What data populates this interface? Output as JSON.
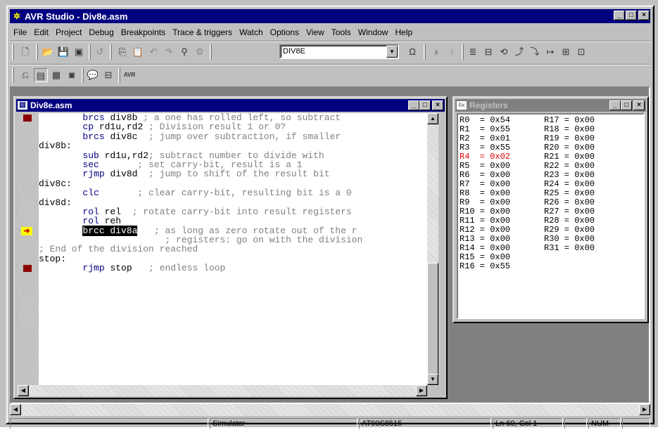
{
  "window": {
    "title": "AVR Studio - Div8e.asm",
    "min": "_",
    "max": "□",
    "close": "×"
  },
  "menu": [
    "File",
    "Edit",
    "Project",
    "Debug",
    "Breakpoints",
    "Trace & triggers",
    "Watch",
    "Options",
    "View",
    "Tools",
    "Window",
    "Help"
  ],
  "toolbar": {
    "combo_value": "DIV8E"
  },
  "code_window": {
    "title": "Div8e.asm",
    "lines": [
      {
        "marker": "bp",
        "parts": [
          [
            "        ",
            ""
          ],
          [
            "brcs",
            "kw"
          ],
          [
            " div8b",
            "id"
          ],
          [
            " ; a one has rolled left, so subtract",
            "cm"
          ]
        ]
      },
      {
        "marker": "",
        "parts": [
          [
            "        ",
            ""
          ],
          [
            "cp",
            "kw"
          ],
          [
            " rd1u,rd2",
            "id"
          ],
          [
            " ; Division result 1 or 0?",
            "cm"
          ]
        ]
      },
      {
        "marker": "",
        "parts": [
          [
            "        ",
            ""
          ],
          [
            "brcs",
            "kw"
          ],
          [
            " div8c",
            "id"
          ],
          [
            "  ; jump over subtraction, if smaller",
            "cm"
          ]
        ]
      },
      {
        "marker": "",
        "parts": [
          [
            "div8b:",
            "id"
          ]
        ]
      },
      {
        "marker": "",
        "parts": [
          [
            "        ",
            ""
          ],
          [
            "sub",
            "kw"
          ],
          [
            " rd1u,rd2",
            "id"
          ],
          [
            "; subtract number to divide with",
            "cm"
          ]
        ]
      },
      {
        "marker": "",
        "parts": [
          [
            "        ",
            ""
          ],
          [
            "sec",
            "kw"
          ],
          [
            "       ; set carry-bit, result is a 1",
            "cm"
          ]
        ]
      },
      {
        "marker": "",
        "parts": [
          [
            "        ",
            ""
          ],
          [
            "rjmp",
            "kw"
          ],
          [
            " div8d",
            "id"
          ],
          [
            "  ; jump to shift of the result bit",
            "cm"
          ]
        ]
      },
      {
        "marker": "",
        "parts": [
          [
            "div8c:",
            "id"
          ]
        ]
      },
      {
        "marker": "",
        "parts": [
          [
            "        ",
            ""
          ],
          [
            "clc",
            "kw"
          ],
          [
            "       ; clear carry-bit, resulting bit is a 0",
            "cm"
          ]
        ]
      },
      {
        "marker": "",
        "parts": [
          [
            "div8d:",
            "id"
          ]
        ]
      },
      {
        "marker": "",
        "parts": [
          [
            "        ",
            ""
          ],
          [
            "rol",
            "kw"
          ],
          [
            " rel",
            "id"
          ],
          [
            "  ; rotate carry-bit into result registers",
            "cm"
          ]
        ]
      },
      {
        "marker": "",
        "parts": [
          [
            "        ",
            ""
          ],
          [
            "rol",
            "kw"
          ],
          [
            " reh",
            "id"
          ]
        ]
      },
      {
        "marker": "arrow",
        "parts": [
          [
            "        ",
            ""
          ],
          [
            "brcc div8a",
            "hl"
          ],
          [
            "   ; as long as zero rotate out of the r",
            "cm"
          ]
        ]
      },
      {
        "marker": "",
        "parts": [
          [
            "                       ; registers: go on with the division",
            "cm"
          ]
        ]
      },
      {
        "marker": "",
        "parts": [
          [
            "; End of the division reached",
            "cm"
          ]
        ]
      },
      {
        "marker": "",
        "parts": [
          [
            "stop:",
            "id"
          ]
        ]
      },
      {
        "marker": "bp",
        "parts": [
          [
            "        ",
            ""
          ],
          [
            "rjmp",
            "kw"
          ],
          [
            " stop",
            "id"
          ],
          [
            "   ; endless loop",
            "cm"
          ]
        ]
      }
    ]
  },
  "registers_window": {
    "title": "Registers",
    "col1": [
      {
        "name": "R0",
        "value": "0x54"
      },
      {
        "name": "R1",
        "value": "0x55"
      },
      {
        "name": "R2",
        "value": "0x01"
      },
      {
        "name": "R3",
        "value": "0x55"
      },
      {
        "name": "R4",
        "value": "0x02",
        "changed": true
      },
      {
        "name": "R5",
        "value": "0x00"
      },
      {
        "name": "R6",
        "value": "0x00"
      },
      {
        "name": "R7",
        "value": "0x00"
      },
      {
        "name": "R8",
        "value": "0x00"
      },
      {
        "name": "R9",
        "value": "0x00"
      },
      {
        "name": "R10",
        "value": "0x00"
      },
      {
        "name": "R11",
        "value": "0x00"
      },
      {
        "name": "R12",
        "value": "0x00"
      },
      {
        "name": "R13",
        "value": "0x00"
      },
      {
        "name": "R14",
        "value": "0x00"
      },
      {
        "name": "R15",
        "value": "0x00"
      },
      {
        "name": "R16",
        "value": "0x55"
      }
    ],
    "col2": [
      {
        "name": "R17",
        "value": "0x00"
      },
      {
        "name": "R18",
        "value": "0x00"
      },
      {
        "name": "R19",
        "value": "0x00"
      },
      {
        "name": "R20",
        "value": "0x00"
      },
      {
        "name": "R21",
        "value": "0x00"
      },
      {
        "name": "R22",
        "value": "0x00"
      },
      {
        "name": "R23",
        "value": "0x00"
      },
      {
        "name": "R24",
        "value": "0x00"
      },
      {
        "name": "R25",
        "value": "0x00"
      },
      {
        "name": "R26",
        "value": "0x00"
      },
      {
        "name": "R27",
        "value": "0x00"
      },
      {
        "name": "R28",
        "value": "0x00"
      },
      {
        "name": "R29",
        "value": "0x00"
      },
      {
        "name": "R30",
        "value": "0x00"
      },
      {
        "name": "R31",
        "value": "0x00"
      }
    ]
  },
  "status": {
    "mode": "Simulator",
    "device": "AT90S8515",
    "position": "Ln 60, Col 1",
    "num": "NUM"
  },
  "colors": {
    "title_active": "#000080",
    "title_inactive": "#808080",
    "changed_register": "#e00000",
    "code_keyword": "#000080"
  }
}
